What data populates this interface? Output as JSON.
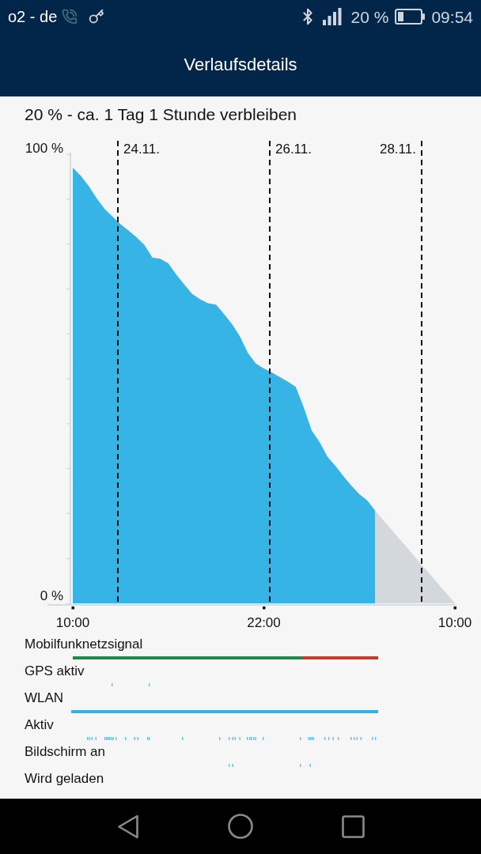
{
  "status_bar": {
    "carrier": "o2 - de",
    "battery_percent": "20 %",
    "time": "09:54"
  },
  "title_bar": {
    "title": "Verlaufsdetails"
  },
  "summary": "20 % - ca. 1 Tag 1 Stunde verbleiben",
  "history_chart": {
    "chart_data": {
      "type": "area",
      "categories": [
        "10:00",
        null,
        null,
        null,
        null,
        null,
        null,
        null,
        null,
        null,
        null,
        null,
        null,
        null,
        null,
        null,
        null,
        null,
        null,
        null,
        null,
        null,
        null,
        null,
        "22:00",
        null,
        null,
        null,
        null,
        null,
        null,
        null,
        null,
        null,
        null,
        null,
        null,
        null,
        null,
        null,
        null,
        null,
        null,
        null,
        null,
        null,
        null,
        null,
        "10:00"
      ],
      "series": [
        {
          "color": "#35b4e5",
          "values": [
            97,
            95.2,
            92.9,
            90.2,
            87.8,
            86.1,
            84.4,
            83,
            81.5,
            79.8,
            77,
            76.7,
            75.7,
            73.2,
            71,
            68.9,
            67.7,
            66.8,
            66.5,
            64.4,
            62.2,
            59.4,
            55.7,
            53.4,
            52.3,
            51.4,
            50.4,
            49.4,
            48.2,
            43.7,
            38.5,
            35.9,
            32.6,
            30.6,
            28.3,
            26.2,
            24.3,
            22.9,
            20.6,
            null,
            null,
            null,
            null,
            null,
            null,
            null,
            null,
            null,
            null
          ]
        },
        {
          "color": "#d2d8db",
          "values": [
            null,
            null,
            null,
            null,
            null,
            null,
            null,
            null,
            null,
            null,
            null,
            null,
            null,
            null,
            null,
            null,
            null,
            null,
            null,
            null,
            null,
            null,
            null,
            null,
            null,
            null,
            null,
            null,
            null,
            null,
            null,
            null,
            null,
            null,
            null,
            null,
            null,
            null,
            20.6,
            18.5,
            16.5,
            14.4,
            12.4,
            10.3,
            8.2,
            6.2,
            4.1,
            2.1,
            0
          ]
        }
      ],
      "ylim": [
        0,
        100
      ],
      "yticks": [
        {
          "value": 0,
          "label": "0 %"
        },
        {
          "value": 100,
          "label": "100 %"
        }
      ],
      "annotations": [
        "24.11.",
        "26.11.",
        "28.11."
      ]
    }
  },
  "tracks": [
    {
      "label": "Mobilfunknetzsignal",
      "kind": "signal"
    },
    {
      "label": "GPS aktiv",
      "kind": "gps"
    },
    {
      "label": "WLAN",
      "kind": "wlan"
    },
    {
      "label": "Aktiv",
      "kind": "activity"
    },
    {
      "label": "Bildschirm an",
      "kind": "screen"
    },
    {
      "label": "Wird geladen",
      "kind": "charging"
    }
  ]
}
